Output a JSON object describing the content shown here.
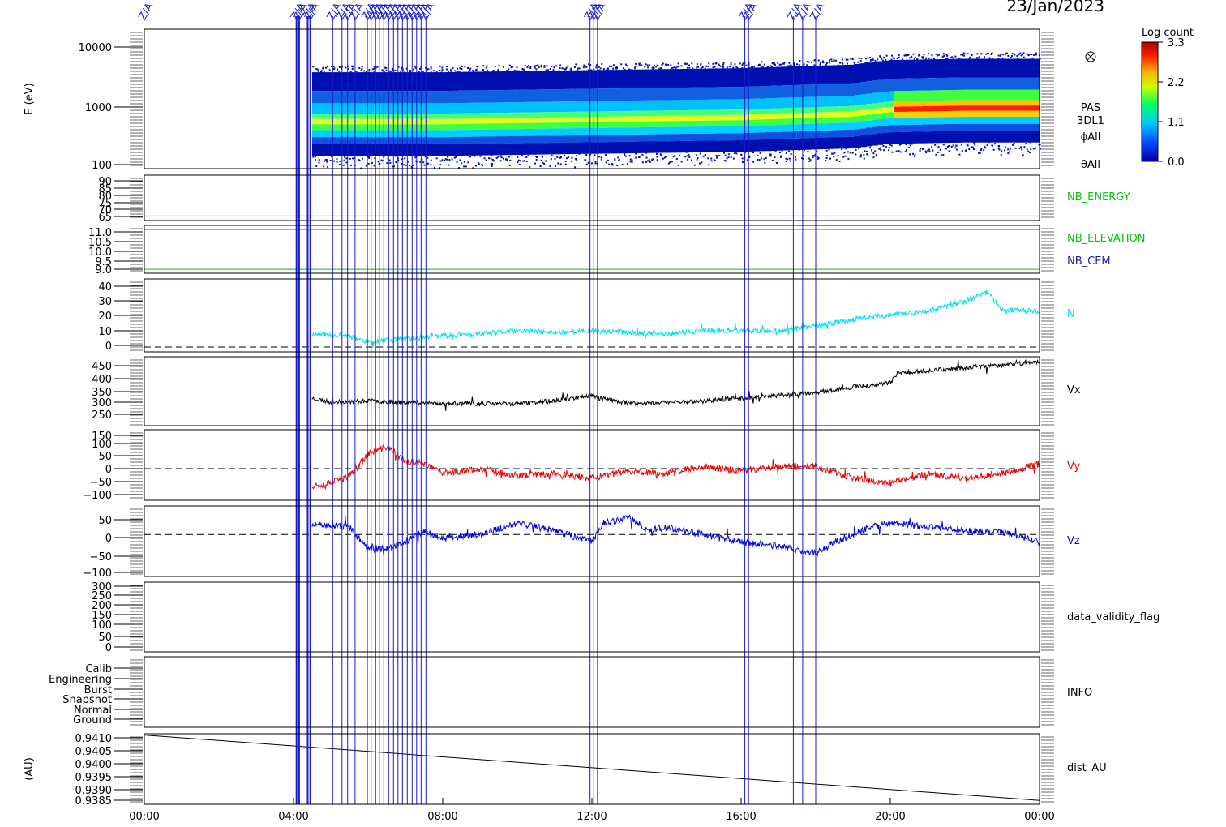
{
  "chart_data": {
    "type": "line",
    "date": "23/Jan/2023",
    "x_tick_labels": [
      "00:00",
      "04:00",
      "08:00",
      "12:00",
      "16:00",
      "20:00",
      "00:00"
    ],
    "x_range_hours": [
      0,
      24
    ],
    "event_label": "Z/A",
    "event_times_hours": [
      4.08,
      4.15,
      4.38,
      4.45,
      5.05,
      5.3,
      5.45,
      5.65,
      5.98,
      6.08,
      6.2,
      6.3,
      6.42,
      6.55,
      6.68,
      6.8,
      6.92,
      7.05,
      7.18,
      7.3,
      7.42,
      7.55,
      11.95,
      12.05,
      12.15,
      16.1,
      16.2,
      17.4,
      17.65,
      18.0
    ],
    "colorbar": {
      "title": "Log count",
      "ticks": [
        "3.3",
        "2.2",
        "1.1",
        "0.0"
      ],
      "range": [
        0.0,
        3.3
      ]
    },
    "panels": [
      {
        "id": "energy_spectrogram",
        "type": "heatmap",
        "ylabel": "E (eV)",
        "y_scale": "log",
        "ylim": [
          100,
          20000
        ],
        "y_ticks": [
          "10000",
          "1000",
          "100"
        ],
        "labels": [
          "PAS",
          "3DL1",
          "ϕAll",
          "θAll"
        ],
        "data_start_hours": 4.5,
        "peak_energy_eV": [
          [
            4.5,
            600
          ],
          [
            8,
            600
          ],
          [
            12,
            650
          ],
          [
            16,
            700
          ],
          [
            19,
            800
          ],
          [
            20,
            950
          ],
          [
            22,
            1000
          ],
          [
            24,
            1000
          ]
        ]
      },
      {
        "id": "nb_energy",
        "type": "line",
        "y_ticks": [
          "90",
          "85",
          "80",
          "75",
          "70",
          "65"
        ],
        "ylim": [
          62,
          92
        ],
        "series": [
          {
            "name": "NB_ENERGY",
            "color": "#00c800",
            "points": [
              [
                0,
                65
              ],
              [
                24,
                65
              ]
            ]
          }
        ]
      },
      {
        "id": "nb_elevation_cem",
        "type": "line",
        "y_ticks": [
          "11.0",
          "10.5",
          "10.0",
          "9.5",
          "9.0"
        ],
        "ylim": [
          8.8,
          11.2
        ],
        "series": [
          {
            "name": "NB_ELEVATION",
            "color": "#00c800",
            "points": [
              [
                0,
                9.0
              ],
              [
                24,
                9.0
              ]
            ]
          },
          {
            "name": "NB_CEM",
            "color": "#2222aa",
            "points": [
              [
                0,
                11.0
              ],
              [
                24,
                11.0
              ]
            ]
          }
        ]
      },
      {
        "id": "density",
        "type": "line",
        "y_ticks": [
          "40",
          "30",
          "20",
          "10",
          "0"
        ],
        "ylim": [
          -3,
          42
        ],
        "zero_line": true,
        "series": [
          {
            "name": "N",
            "color": "#00e0f0",
            "noise": 1.6,
            "seed": 11,
            "points": [
              [
                4.5,
                8
              ],
              [
                5.5,
                7
              ],
              [
                6,
                3
              ],
              [
                7,
                5
              ],
              [
                8,
                7
              ],
              [
                9,
                8
              ],
              [
                10,
                10
              ],
              [
                11,
                9
              ],
              [
                12,
                10
              ],
              [
                13,
                9
              ],
              [
                14,
                8
              ],
              [
                15,
                10
              ],
              [
                16,
                10
              ],
              [
                17,
                10
              ],
              [
                18,
                13
              ],
              [
                19,
                17
              ],
              [
                20,
                20
              ],
              [
                21,
                22
              ],
              [
                22,
                28
              ],
              [
                22.6,
                34
              ],
              [
                23,
                23
              ],
              [
                24,
                22
              ]
            ]
          }
        ]
      },
      {
        "id": "vx",
        "type": "line",
        "y_ticks": [
          "450",
          "400",
          "350",
          "300",
          "250"
        ],
        "ylim": [
          220,
          470
        ],
        "series": [
          {
            "name": "Vx",
            "color": "#000000",
            "noise": 8,
            "seed": 23,
            "points": [
              [
                4.5,
                320
              ],
              [
                5,
                305
              ],
              [
                6,
                310
              ],
              [
                7,
                305
              ],
              [
                8,
                300
              ],
              [
                10,
                300
              ],
              [
                11,
                310
              ],
              [
                12,
                330
              ],
              [
                12.2,
                320
              ],
              [
                13,
                300
              ],
              [
                14,
                305
              ],
              [
                15,
                310
              ],
              [
                16,
                320
              ],
              [
                17,
                330
              ],
              [
                18,
                340
              ],
              [
                19,
                360
              ],
              [
                20,
                375
              ],
              [
                20.2,
                410
              ],
              [
                21,
                420
              ],
              [
                22,
                430
              ],
              [
                23,
                440
              ],
              [
                24,
                450
              ]
            ]
          }
        ]
      },
      {
        "id": "vy",
        "type": "line",
        "y_ticks": [
          "150",
          "100",
          "50",
          "0",
          "−50",
          "−100"
        ],
        "ylim": [
          -130,
          160
        ],
        "zero_line": true,
        "series": [
          {
            "name": "Vy",
            "color": "#ee0000",
            "noise": 14,
            "seed": 37,
            "points": [
              [
                4.5,
                -70
              ],
              [
                5,
                -60
              ],
              [
                5.5,
                -30
              ],
              [
                6,
                60
              ],
              [
                6.5,
                90
              ],
              [
                7,
                30
              ],
              [
                7.5,
                20
              ],
              [
                8,
                -20
              ],
              [
                9,
                0
              ],
              [
                10,
                -30
              ],
              [
                11,
                -20
              ],
              [
                12,
                -40
              ],
              [
                13,
                -10
              ],
              [
                14,
                -20
              ],
              [
                15,
                10
              ],
              [
                16,
                -10
              ],
              [
                17,
                10
              ],
              [
                18,
                10
              ],
              [
                19,
                -40
              ],
              [
                20,
                -60
              ],
              [
                21,
                -20
              ],
              [
                22,
                -40
              ],
              [
                23,
                -20
              ],
              [
                24,
                20
              ]
            ]
          }
        ]
      },
      {
        "id": "vz",
        "type": "line",
        "y_ticks": [
          "50",
          "0",
          "−50",
          "−100"
        ],
        "ylim": [
          -110,
          75
        ],
        "zero_line": true,
        "series": [
          {
            "name": "Vz",
            "color": "#0000dd",
            "noise": 9,
            "seed": 51,
            "points": [
              [
                4.5,
                25
              ],
              [
                5.5,
                20
              ],
              [
                6,
                -40
              ],
              [
                6.8,
                -30
              ],
              [
                7.5,
                10
              ],
              [
                8,
                -10
              ],
              [
                9,
                0
              ],
              [
                10,
                30
              ],
              [
                11,
                10
              ],
              [
                12,
                -20
              ],
              [
                12.3,
                30
              ],
              [
                13,
                45
              ],
              [
                13.5,
                10
              ],
              [
                14,
                20
              ],
              [
                15,
                0
              ],
              [
                16,
                -20
              ],
              [
                17,
                -30
              ],
              [
                18,
                -50
              ],
              [
                18.5,
                -20
              ],
              [
                19,
                0
              ],
              [
                19.5,
                20
              ],
              [
                20,
                30
              ],
              [
                21,
                20
              ],
              [
                22,
                10
              ],
              [
                23,
                5
              ],
              [
                24,
                -20
              ]
            ]
          }
        ]
      },
      {
        "id": "data_validity_flag",
        "type": "line",
        "y_ticks": [
          "300",
          "250",
          "200",
          "150",
          "100",
          "50",
          "0"
        ],
        "ylim": [
          -15,
          310
        ],
        "series": [
          {
            "name": "data_validity_flag",
            "color": "#000000",
            "points": []
          }
        ]
      },
      {
        "id": "info",
        "type": "line",
        "y_ticks": [
          "Calib",
          "Engineering",
          "Burst",
          "Snapshot",
          "Normal",
          "Ground"
        ],
        "ylim": [
          0,
          7
        ],
        "series": [
          {
            "name": "INFO",
            "color": "#000000",
            "points": []
          }
        ]
      },
      {
        "id": "distance",
        "type": "line",
        "ylabel": "(AU)",
        "y_ticks": [
          "0.9410",
          "0.9405",
          "0.9400",
          "0.9395",
          "0.9390",
          "0.9385"
        ],
        "ylim": [
          0.9384,
          0.9411
        ],
        "series": [
          {
            "name": "dist_AU",
            "color": "#000000",
            "points": [
              [
                0,
                0.94105
              ],
              [
                24,
                0.93855
              ]
            ]
          }
        ]
      }
    ]
  }
}
